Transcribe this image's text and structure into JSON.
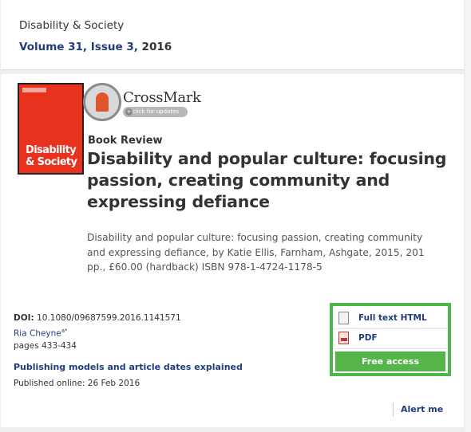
{
  "header": {
    "journal": "Disability & Society",
    "volume_issue": "Volume 31, Issue 3,",
    "year": "2016"
  },
  "cover": {
    "title_line1": "Disability",
    "title_line2": "& Society",
    "accent": "#e8321e"
  },
  "crossmark": {
    "label": "CrossMark",
    "sub": "click for updates"
  },
  "article": {
    "type": "Book Review",
    "title": "Disability and popular culture: focusing passion, creating community and expressing defiance",
    "citation": "Disability and popular culture: focusing passion, creating community and expressing defiance, by Katie Ellis, Farnham, Ashgate, 2015, 201 pp., £60.00 (hardback) ISBN 978-1-4724-1178-5"
  },
  "meta": {
    "doi_label": "DOI:",
    "doi_value": "10.1080/09687599.2016.1141571",
    "author": "Ria Cheyne",
    "author_sup": "a*",
    "pages": "pages 433-434",
    "publishing_models": "Publishing models and article dates explained",
    "published_online": "Published online: 26 Feb 2016"
  },
  "access": {
    "full_text": "Full text HTML",
    "pdf": "PDF",
    "free_access": "Free access",
    "accent": "#4bb84b"
  },
  "alert": {
    "label": "Alert me"
  }
}
